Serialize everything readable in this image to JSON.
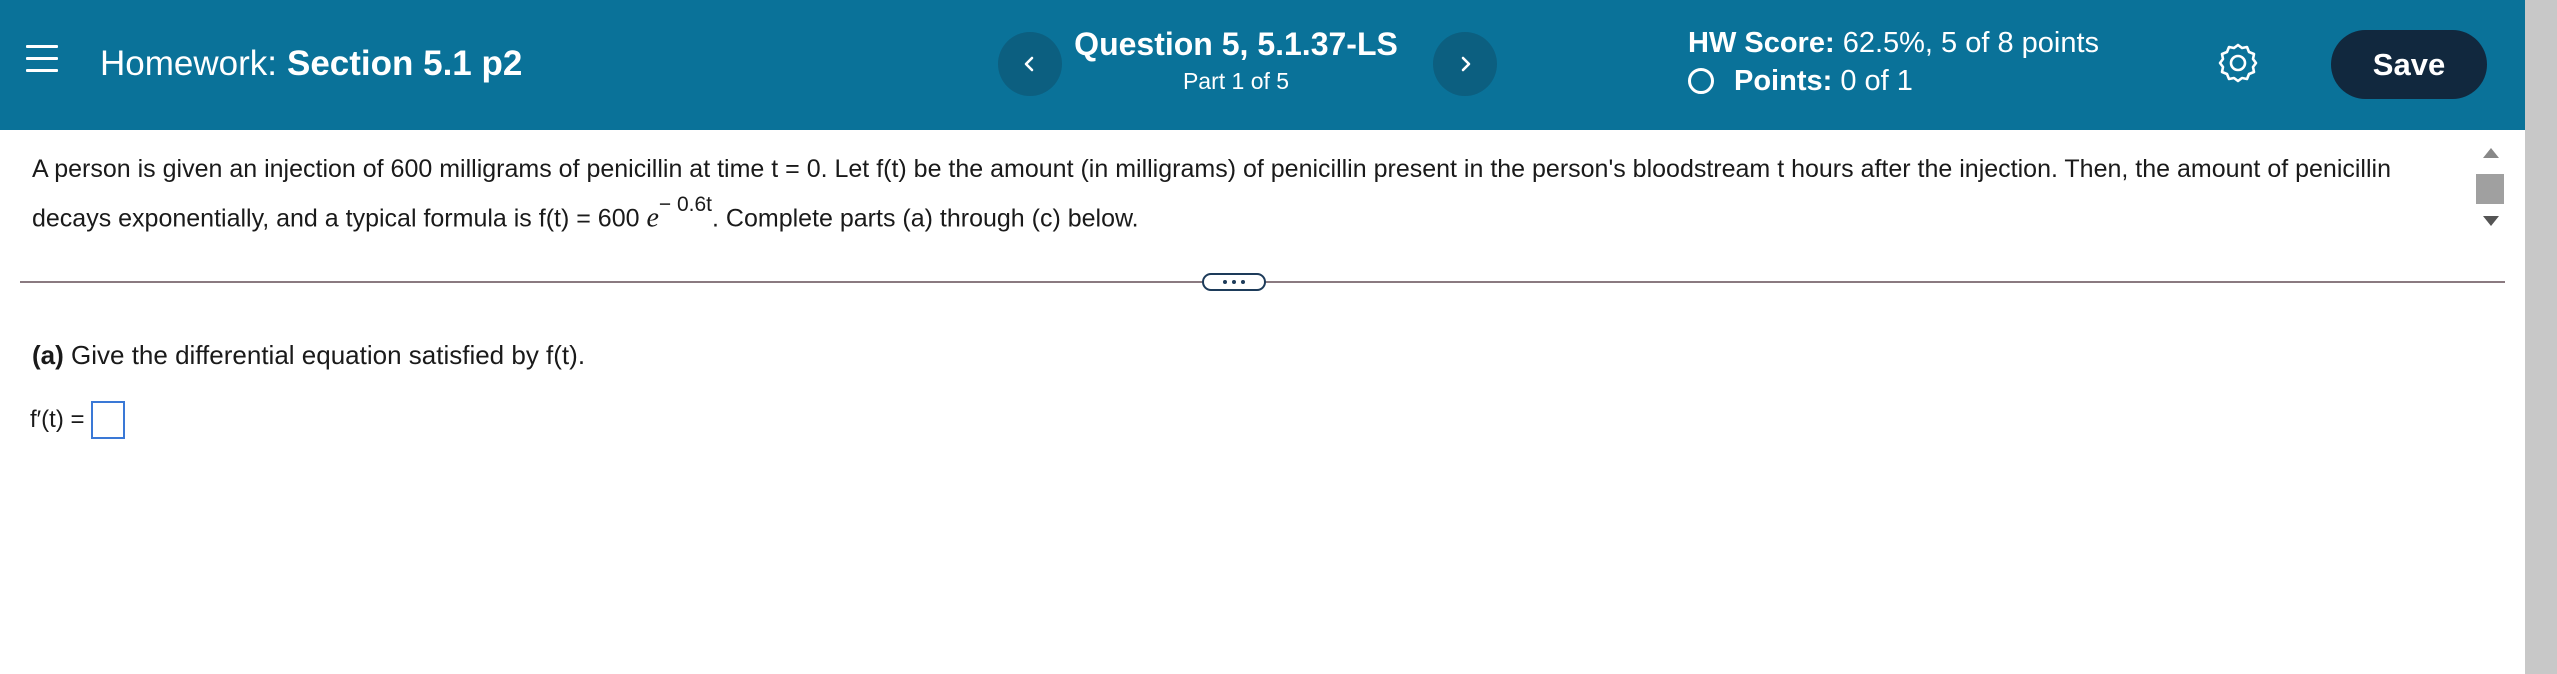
{
  "header": {
    "hw_prefix": "Homework:",
    "hw_section": "Section 5.1 p2",
    "question_title": "Question 5, 5.1.37-LS",
    "question_part": "Part 1 of 5",
    "score_label": "HW Score:",
    "score_value": "62.5%, 5 of 8 points",
    "points_label": "Points:",
    "points_value": "0 of 1",
    "save_label": "Save",
    "colors": {
      "bar": "#0a7299",
      "nav_button": "#0c5f80",
      "save_button": "#11283e"
    },
    "icons": {
      "menu": "hamburger-icon",
      "prev": "chevron-left-icon",
      "next": "chevron-right-icon",
      "settings": "gear-icon",
      "points_status": "circle-outline-icon"
    }
  },
  "question": {
    "text_1": "A person is given an injection of 600 milligrams of penicillin at time t = 0. Let f(t) be the amount (in milligrams) of penicillin present in the person's bloodstream t hours after the injection. Then, the amount of penicillin decays exponentially, and a typical formula is f(t) = 600",
    "base": "e",
    "exponent": "− 0.6t",
    "text_2": ". Complete parts (a) through (c) below."
  },
  "part_a": {
    "label": "(a)",
    "prompt": "Give the differential equation satisfied by f(t).",
    "lhs": "f′(t) =",
    "answer_value": ""
  }
}
